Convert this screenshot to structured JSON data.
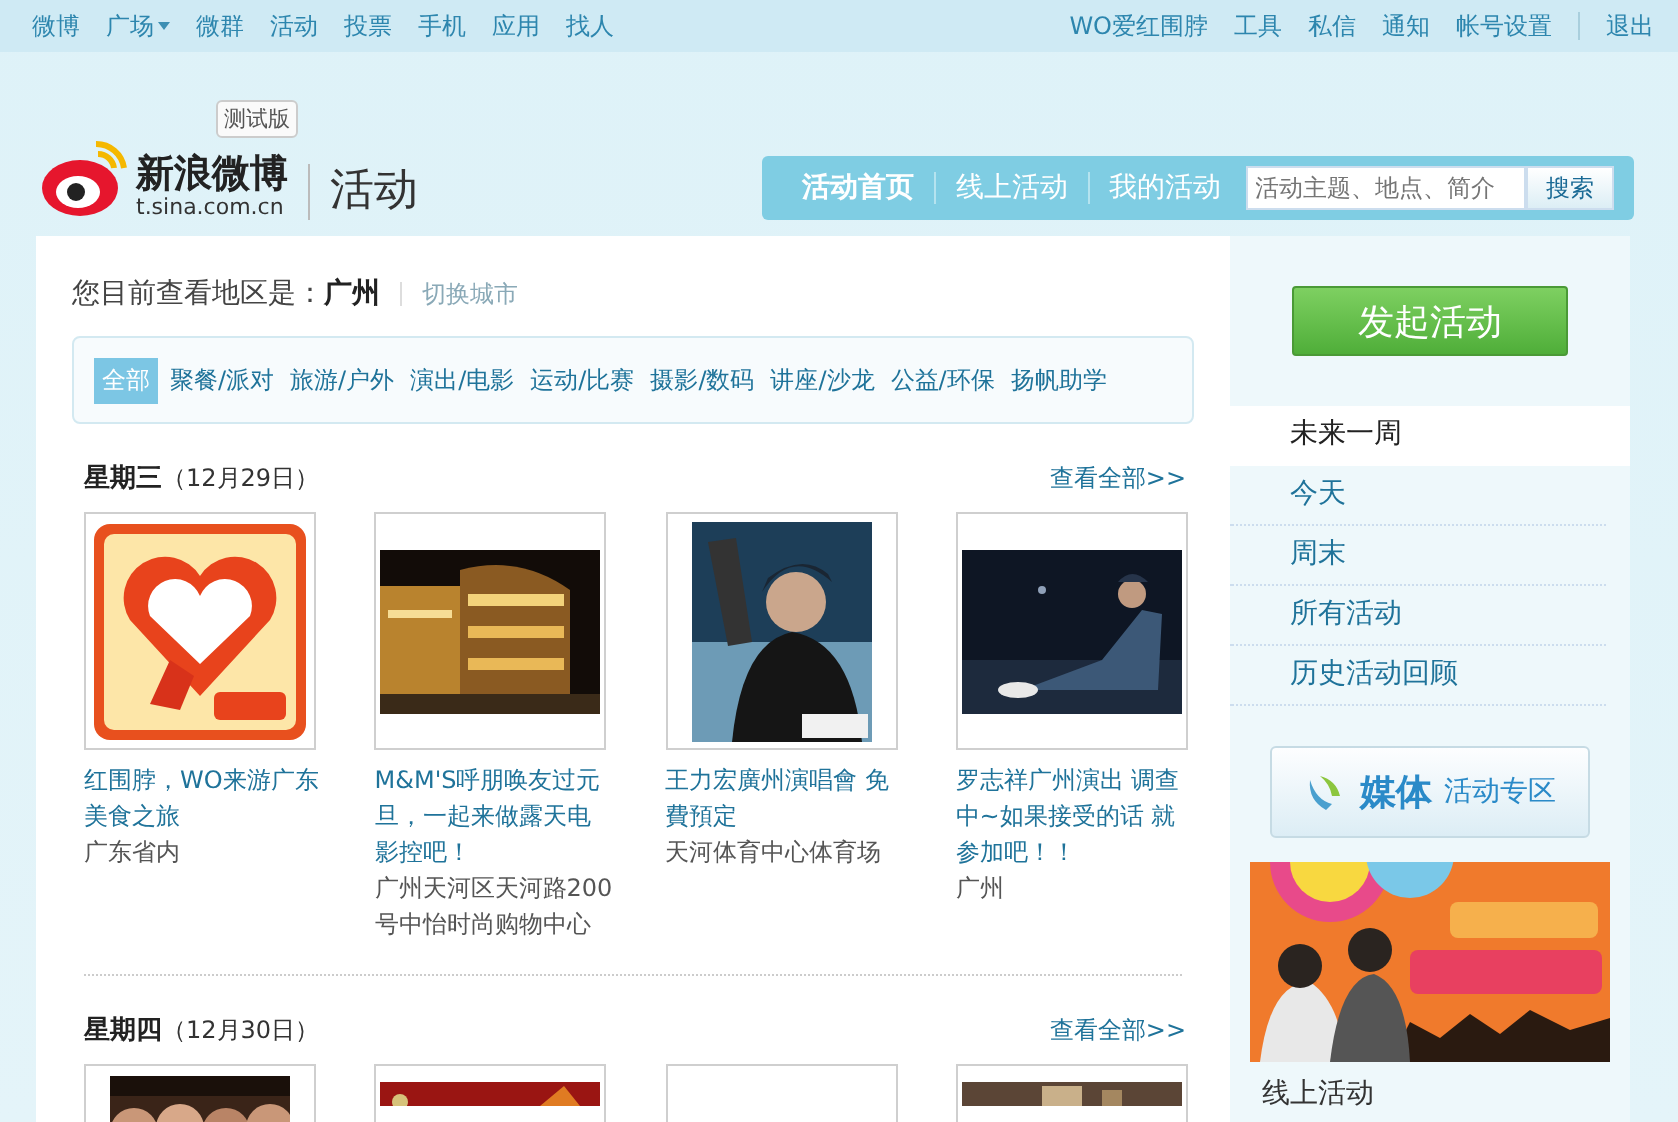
{
  "top_nav": {
    "left": [
      {
        "label": "微博",
        "caret": false
      },
      {
        "label": "广场",
        "caret": true
      },
      {
        "label": "微群",
        "caret": false
      },
      {
        "label": "活动",
        "caret": false
      },
      {
        "label": "投票",
        "caret": false
      },
      {
        "label": "手机",
        "caret": false
      },
      {
        "label": "应用",
        "caret": false
      },
      {
        "label": "找人",
        "caret": false
      }
    ],
    "right": [
      "WO爱红围脖",
      "工具",
      "私信",
      "通知",
      "帐号设置",
      "退出"
    ]
  },
  "header": {
    "logo": "新浪微博",
    "domain": "t.sina.com.cn",
    "badge": "测试版",
    "section": "活动",
    "tabs": [
      {
        "label": "活动首页",
        "selected": true
      },
      {
        "label": "线上活动",
        "selected": false
      },
      {
        "label": "我的活动",
        "selected": false
      }
    ],
    "search": {
      "placeholder": "活动主题、地点、简介",
      "button": "搜索"
    }
  },
  "region": {
    "prompt": "您目前查看地区是：",
    "city": "广州",
    "switch": "切换城市"
  },
  "categories": [
    {
      "label": "全部",
      "selected": true
    },
    {
      "label": "聚餐/派对",
      "selected": false
    },
    {
      "label": "旅游/户外",
      "selected": false
    },
    {
      "label": "演出/电影",
      "selected": false
    },
    {
      "label": "运动/比赛",
      "selected": false
    },
    {
      "label": "摄影/数码",
      "selected": false
    },
    {
      "label": "讲座/沙龙",
      "selected": false
    },
    {
      "label": "公益/环保",
      "selected": false
    },
    {
      "label": "扬帆助学",
      "selected": false
    }
  ],
  "days": [
    {
      "weekday": "星期三",
      "date": "（12月29日）",
      "view_all": "查看全部>>",
      "events": [
        {
          "title": "红围脖，WO来游广东美食之旅",
          "location": "广东省内"
        },
        {
          "title": "M&M'S呼朋唤友过元旦，一起来做露天电影控吧！",
          "location": "广州天河区天河路200号中怡时尚购物中心"
        },
        {
          "title": "王力宏廣州演唱會 免費預定",
          "location": "天河体育中心体育场"
        },
        {
          "title": "罗志祥广州演出 调查中~如果接受的话 就参加吧！！",
          "location": "广州"
        }
      ]
    },
    {
      "weekday": "星期四",
      "date": "（12月30日）",
      "view_all": "查看全部>>",
      "events": [
        {
          "kind": "picture"
        },
        {
          "kind": "picture"
        },
        {
          "kind": "blank"
        },
        {
          "kind": "picture"
        }
      ]
    }
  ],
  "sidebar": {
    "create_button": "发起活动",
    "filters": [
      {
        "label": "未来一周",
        "selected": true
      },
      {
        "label": "今天",
        "selected": false
      },
      {
        "label": "周末",
        "selected": false
      },
      {
        "label": "所有活动",
        "selected": false
      },
      {
        "label": "历史活动回顾",
        "selected": false
      }
    ],
    "media_button": {
      "strong": "媒体",
      "label": "活动专区"
    },
    "banner": {
      "kind": "picture"
    },
    "section_heading": "线上活动"
  }
}
